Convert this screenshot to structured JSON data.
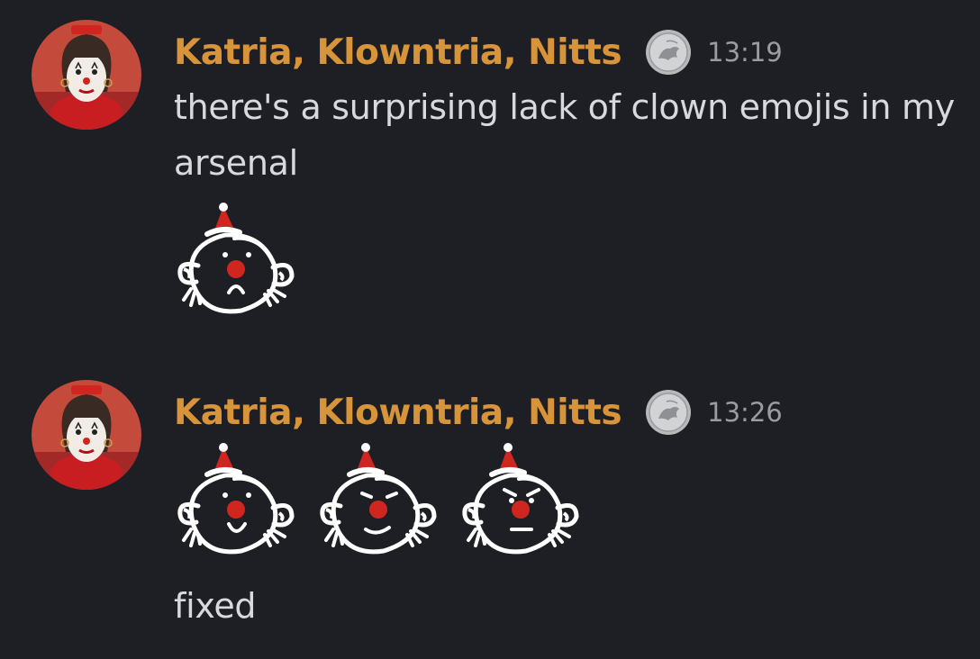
{
  "messages": [
    {
      "author": "Katria, Klowntria, Nitts",
      "time": "13:19",
      "text": "there's a surprising lack of clown emojis in my arsenal",
      "emojis": [
        "clown-sad-emoji"
      ]
    },
    {
      "author": "Katria, Klowntria, Nitts",
      "time": "13:26",
      "emojis": [
        "clown-happy-emoji",
        "clown-smirk-emoji",
        "clown-angry-emoji"
      ],
      "text": "fixed"
    }
  ],
  "colors": {
    "background": "#1e1f24",
    "username": "#d8943a",
    "message_text": "#d7d9dc",
    "timestamp": "#9a9ca3"
  }
}
